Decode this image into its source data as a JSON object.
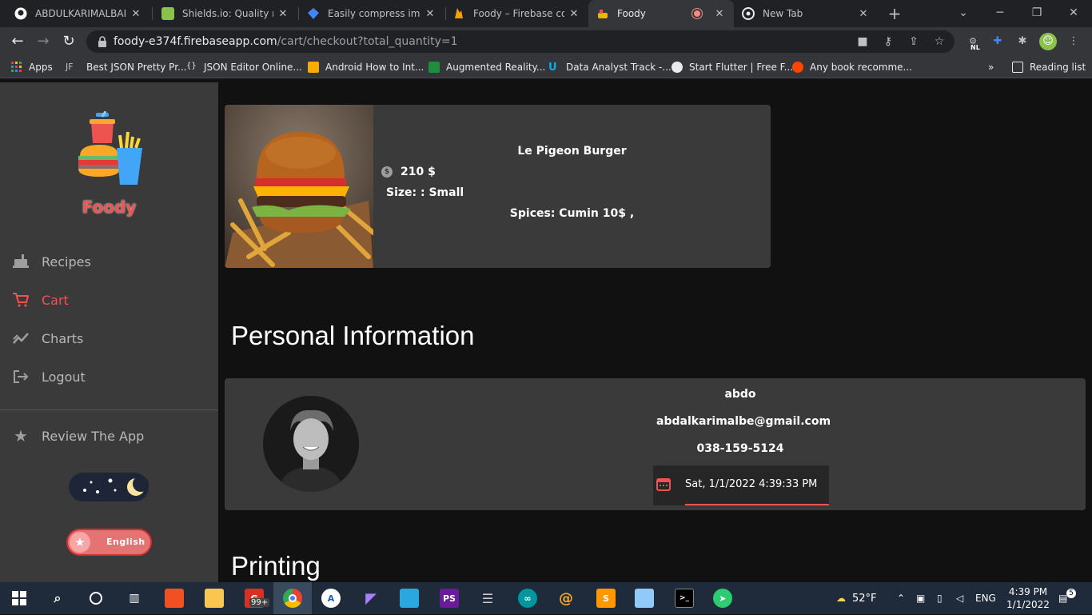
{
  "browser": {
    "tabs": [
      {
        "title": "ABDULKARIMALBAIK/",
        "icon": "github-icon",
        "color": "#ffffff"
      },
      {
        "title": "Shields.io: Quality met",
        "icon": "shields-icon",
        "color": "#8bc34a"
      },
      {
        "title": "Easily compress image",
        "icon": "compress-icon",
        "color": "#4285f4"
      },
      {
        "title": "Foody – Firebase cons",
        "icon": "firebase-icon",
        "color": "#ffa000"
      },
      {
        "title": "Foody",
        "icon": "foody-icon",
        "color": "#f4b400",
        "active": true
      },
      {
        "title": "New Tab",
        "icon": "chrome-icon",
        "color": "#ffffff"
      }
    ],
    "url_host": "foody-e374f.firebaseapp.com",
    "url_path": "/cart/checkout?total_quantity=1",
    "bookmarks": [
      {
        "label": "Apps",
        "icon": "apps-grid-icon"
      },
      {
        "label": "Best JSON Pretty Pr...",
        "icon": "jf-icon"
      },
      {
        "label": "JSON Editor Online...",
        "icon": "braces-icon"
      },
      {
        "label": "Android How to Int...",
        "icon": "android-icon"
      },
      {
        "label": "Augmented Reality...",
        "icon": "ar-icon"
      },
      {
        "label": "Data Analyst Track -...",
        "icon": "udacity-icon"
      },
      {
        "label": "Start Flutter | Free F...",
        "icon": "globe-icon"
      },
      {
        "label": "Any book recomme...",
        "icon": "reddit-icon"
      }
    ],
    "bookmarks_overflow": "»",
    "reading_list": "Reading list",
    "extension_badge": "NL"
  },
  "sidebar": {
    "brand": "Foody",
    "nav": [
      {
        "label": "Recipes",
        "icon": "recipes-icon",
        "active": false
      },
      {
        "label": "Cart",
        "icon": "cart-icon",
        "active": true
      },
      {
        "label": "Charts",
        "icon": "charts-icon",
        "active": false
      },
      {
        "label": "Logout",
        "icon": "logout-icon",
        "active": false
      }
    ],
    "review": {
      "label": "Review The App",
      "icon": "star-icon"
    },
    "theme_mode": "night",
    "language": "English"
  },
  "cart_item": {
    "name": "Le Pigeon Burger",
    "price": "210 $",
    "size": "Size: : Small",
    "spices": "Spices: Cumin 10$ ,"
  },
  "personal": {
    "heading": "Personal Information",
    "name": "abdo",
    "email": "abdalkarimalbe@gmail.com",
    "phone": "038-159-5124",
    "datetime": "Sat, 1/1/2022 4:39:33 PM"
  },
  "printing_heading": "Printing",
  "taskbar": {
    "notification_badge": "99+",
    "weather": "52°F",
    "lang": "ENG",
    "time": "4:39 PM",
    "date": "1/1/2022",
    "action_center_count": "5"
  },
  "colors": {
    "accent": "#ef5350",
    "sidebar": "#3a3a3a",
    "background": "#111111"
  }
}
